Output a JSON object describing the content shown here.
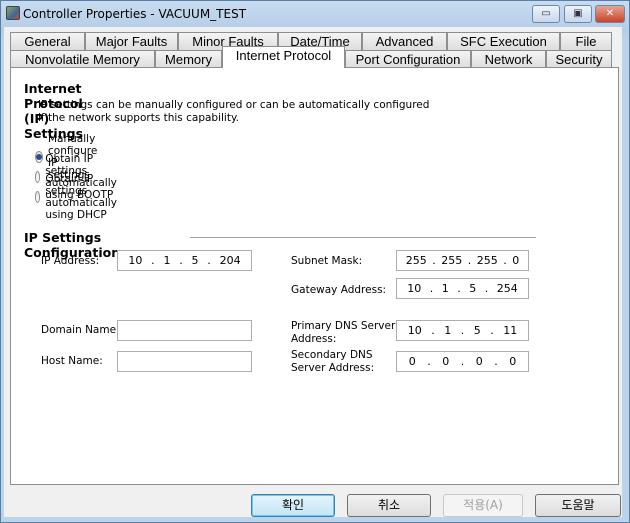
{
  "window": {
    "title": "Controller Properties - VACUUM_TEST",
    "minimize": "▭",
    "maximize": "▣",
    "close": "✕"
  },
  "tabs": {
    "row1": [
      "General",
      "Major Faults",
      "Minor Faults",
      "Date/Time",
      "Advanced",
      "SFC Execution",
      "File"
    ],
    "row2": [
      "Nonvolatile Memory",
      "Memory",
      "Internet Protocol",
      "Port Configuration",
      "Network",
      "Security"
    ],
    "selected": "Internet Protocol"
  },
  "ip": {
    "heading": "Internet Protocol (IP) Settings",
    "desc1": "IP settings can be manually configured or can be automatically configured",
    "desc2": "if the network supports this capability.",
    "options": [
      "Manually configure IP settings",
      "Obtain IP settings automatically using BOOTP",
      "Obtain IP settings automatically using DHCP"
    ],
    "selected_option": 0
  },
  "config": {
    "heading": "IP Settings Configuration",
    "ip_label": "IP Address:",
    "ip": [
      "10",
      "1",
      "5",
      "204"
    ],
    "subnet_label": "Subnet Mask:",
    "subnet": [
      "255",
      "255",
      "255",
      "0"
    ],
    "gateway_label": "Gateway Address:",
    "gateway": [
      "10",
      "1",
      "5",
      "254"
    ],
    "domain_label": "Domain Name:",
    "domain": "",
    "host_label": "Host Name:",
    "host": "",
    "pdns_label1": "Primary DNS Server",
    "pdns_label2": "Address:",
    "pdns": [
      "10",
      "1",
      "5",
      "11"
    ],
    "sdns_label1": "Secondary DNS",
    "sdns_label2": "Server Address:",
    "sdns": [
      "0",
      "0",
      "0",
      "0"
    ]
  },
  "buttons": {
    "ok": "확인",
    "cancel": "취소",
    "apply": "적용(A)",
    "help": "도움말"
  }
}
